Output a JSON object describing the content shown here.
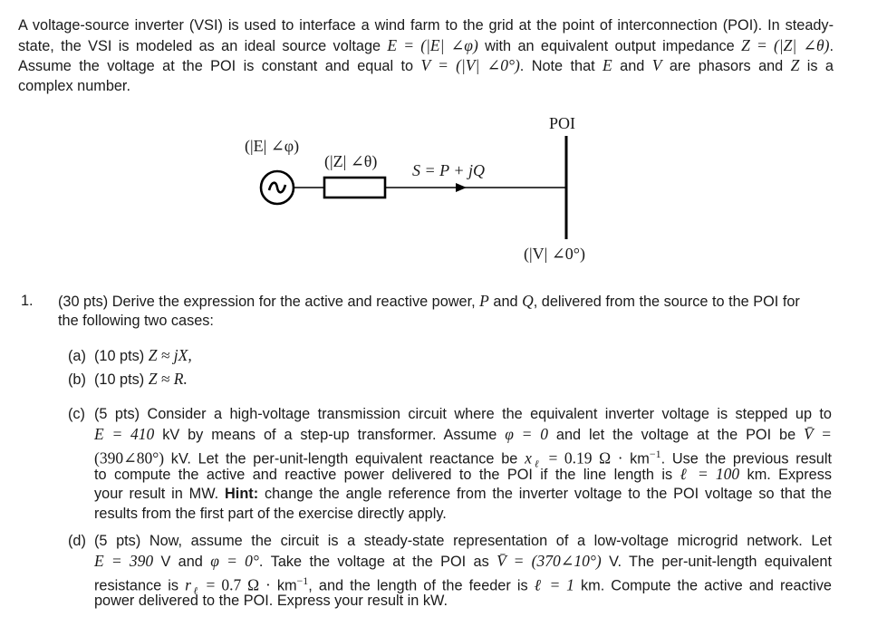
{
  "intro": {
    "lines": [
      "A voltage-source inverter (VSI) is used to interface a wind farm to the grid at the point of interconnection (POI). In steady-",
      [
        "state, the VSI is modeled as an ideal source voltage ",
        "E = (|E| ∠φ)",
        " with an equivalent output impedance ",
        "Z = (|Z| ∠θ)",
        "."
      ],
      [
        "Assume the voltage at the POI is constant and equal to ",
        "V = (|V| ∠0°)",
        ".  Note that ",
        "E",
        " and ",
        "V",
        " are phasors and ",
        "Z",
        " is a"
      ],
      "complex number."
    ]
  },
  "diagram": {
    "source_label": "(|E| ∠φ)",
    "impedance_label": "(|Z| ∠θ)",
    "power_label": "S = P + jQ",
    "bus_label": "POI",
    "bus_voltage_label": "(|V| ∠0°)",
    "source_symbol": "∼"
  },
  "question1": {
    "number": "1.",
    "line1": [
      "(30 pts) Derive the expression for the active and reactive power, ",
      "P",
      " and ",
      "Q",
      ", delivered from the source to the POI for"
    ],
    "line2": "the following two cases:",
    "parts": {
      "a": {
        "label": "(a)",
        "pts": "(10 pts)",
        "expr": "Z ≈ jX,"
      },
      "b": {
        "label": "(b)",
        "pts": "(10 pts)",
        "expr": "Z ≈ R."
      },
      "c": {
        "label": "(c)",
        "lines": [
          "(5 pts) Consider a high-voltage transmission circuit where the equivalent inverter voltage is stepped up to",
          [
            "E = 410",
            " kV by means of a step-up transformer.  Assume ",
            "φ = 0",
            " and let the voltage at the POI be ",
            "V̄ ="
          ],
          [
            "(390∠80°)",
            " kV. Let the per-unit-length equivalent reactance be ",
            "x",
            "ℓ",
            " = 0.19 Ω · ",
            "km",
            "−1",
            ". Use the previous result"
          ],
          [
            "to compute the active and reactive power delivered to the POI if the line length is ",
            "ℓ = 100",
            " km.  Express"
          ],
          [
            "your result in MW. ",
            "Hint:",
            " change the angle reference from the inverter voltage to the POI voltage so that the"
          ],
          "results from the first part of the exercise directly apply."
        ]
      },
      "d": {
        "label": "(d)",
        "lines": [
          "(5 pts) Now, assume the circuit is a steady-state representation of a low-voltage microgrid network.  Let",
          [
            "E = 390",
            " V and ",
            "φ = 0°",
            ".  Take the voltage at the POI as ",
            "V̄ = (370∠10°)",
            " V.  The per-unit-length equivalent"
          ],
          [
            "resistance is ",
            "r",
            "ℓ",
            " = 0.7 Ω · ",
            "km",
            "−1",
            ", and the length of the feeder is ",
            "ℓ = 1",
            " km.  Compute the active and reactive"
          ],
          "power delivered to the POI. Express your result in kW."
        ]
      }
    }
  }
}
